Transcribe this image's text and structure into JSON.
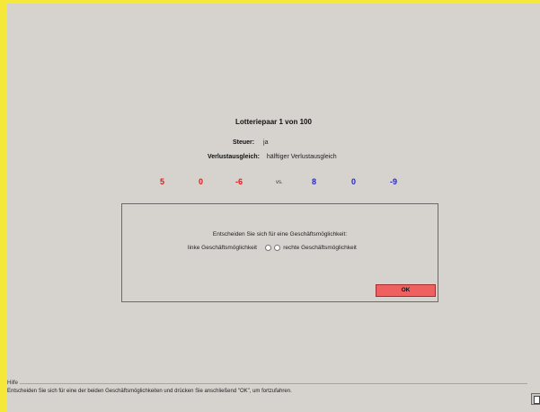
{
  "header": {
    "title": "Lotteriepaar 1 von 100"
  },
  "settings": {
    "tax_label": "Steuer:",
    "tax_value": "ja",
    "loss_label": "Verlustausgleich:",
    "loss_value": "hälftiger Verlustausgleich"
  },
  "lotteries": {
    "left": [
      "5",
      "0",
      "-6"
    ],
    "vs": "vs.",
    "right": [
      "8",
      "0",
      "-9"
    ],
    "left_color": "#e51818",
    "right_color": "#2626c8"
  },
  "decision": {
    "question": "Entscheiden Sie sich für eine Geschäftsmöglichkeit:",
    "left_option": "linke Geschäftsmöglichkeit",
    "right_option": "rechte Geschäftsmöglichkeit",
    "ok_label": "OK",
    "ok_color": "#ef6060"
  },
  "help": {
    "legend": "Hilfe",
    "text": "Entscheiden Sie sich für eine der beiden Geschäftsmöglichkeiten und drücken Sie anschließend \"OK\", um fortzufahren."
  },
  "icons": {
    "corner": "calculator-icon"
  }
}
